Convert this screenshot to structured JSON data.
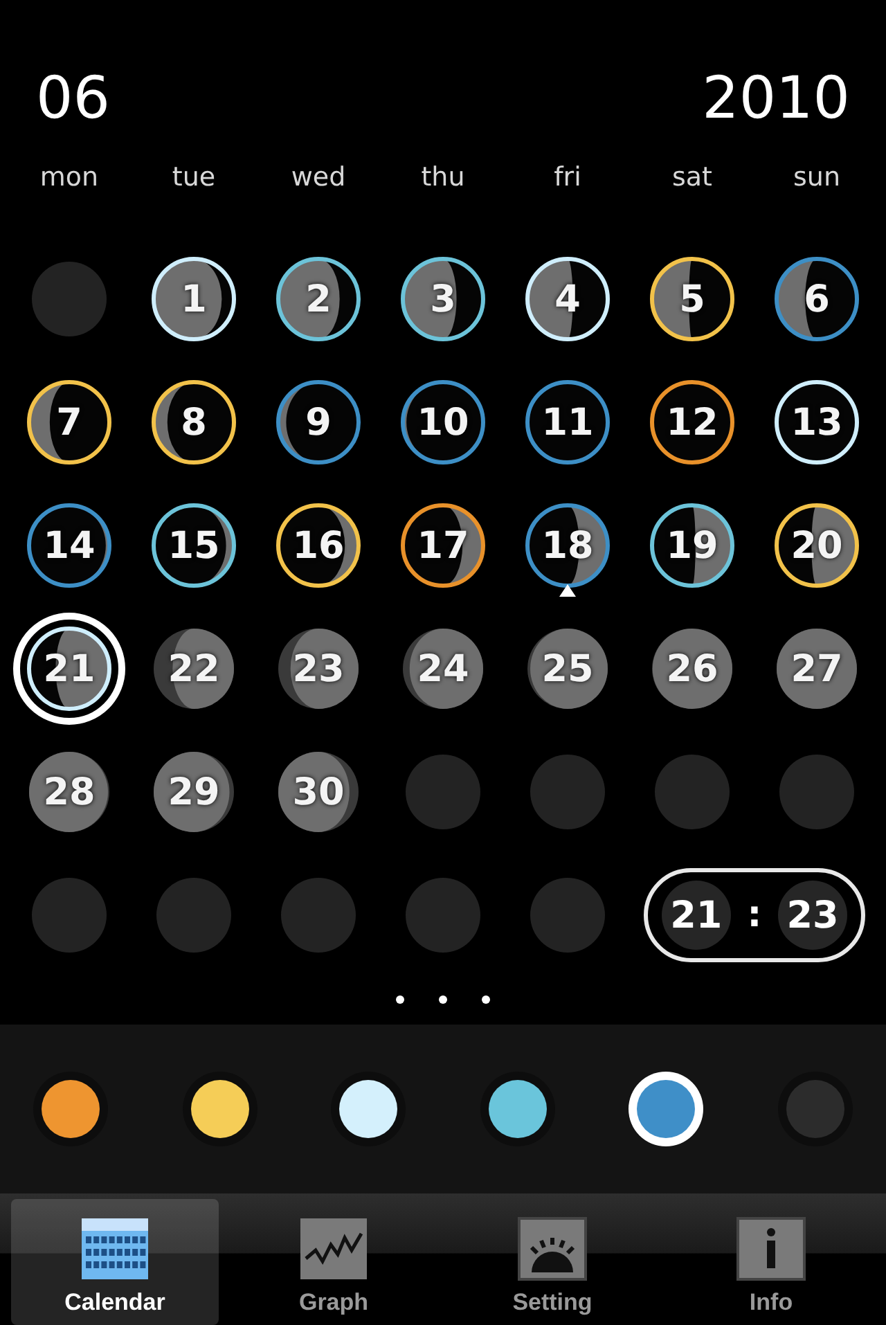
{
  "header": {
    "month": "06",
    "year": "2010"
  },
  "weekdays": [
    "mon",
    "tue",
    "wed",
    "thu",
    "fri",
    "sat",
    "sun"
  ],
  "days": [
    {
      "kind": "empty"
    },
    {
      "kind": "day",
      "label": "1",
      "color": "#cfeefc",
      "selected": false,
      "today": false
    },
    {
      "kind": "day",
      "label": "2",
      "color": "#6cc3d9",
      "selected": false,
      "today": false
    },
    {
      "kind": "day",
      "label": "3",
      "color": "#6cc3d9",
      "selected": false,
      "today": false
    },
    {
      "kind": "day",
      "label": "4",
      "color": "#cfeefc",
      "selected": false,
      "today": false
    },
    {
      "kind": "day",
      "label": "5",
      "color": "#f2c24a",
      "selected": false,
      "today": false
    },
    {
      "kind": "day",
      "label": "6",
      "color": "#3d8fc6",
      "selected": false,
      "today": false
    },
    {
      "kind": "day",
      "label": "7",
      "color": "#f2c24a",
      "selected": false,
      "today": false
    },
    {
      "kind": "day",
      "label": "8",
      "color": "#f2c24a",
      "selected": false,
      "today": false
    },
    {
      "kind": "day",
      "label": "9",
      "color": "#3d8fc6",
      "selected": false,
      "today": false
    },
    {
      "kind": "day",
      "label": "10",
      "color": "#3d8fc6",
      "selected": false,
      "today": false
    },
    {
      "kind": "day",
      "label": "11",
      "color": "#3d8fc6",
      "selected": false,
      "today": false
    },
    {
      "kind": "day",
      "label": "12",
      "color": "#e8912a",
      "selected": false,
      "today": false
    },
    {
      "kind": "day",
      "label": "13",
      "color": "#cfeefc",
      "selected": false,
      "today": false
    },
    {
      "kind": "day",
      "label": "14",
      "color": "#3d8fc6",
      "selected": false,
      "today": false
    },
    {
      "kind": "day",
      "label": "15",
      "color": "#6cc3d9",
      "selected": false,
      "today": false
    },
    {
      "kind": "day",
      "label": "16",
      "color": "#f2c24a",
      "selected": false,
      "today": false
    },
    {
      "kind": "day",
      "label": "17",
      "color": "#e8912a",
      "selected": false,
      "today": false
    },
    {
      "kind": "day",
      "label": "18",
      "color": "#3d8fc6",
      "selected": false,
      "today": true
    },
    {
      "kind": "day",
      "label": "19",
      "color": "#6cc3d9",
      "selected": false,
      "today": false
    },
    {
      "kind": "day",
      "label": "20",
      "color": "#f2c24a",
      "selected": false,
      "today": false
    },
    {
      "kind": "day",
      "label": "21",
      "color": "#cfeefc",
      "selected": true,
      "today": false
    },
    {
      "kind": "day",
      "label": "22",
      "selected": false,
      "today": false
    },
    {
      "kind": "day",
      "label": "23",
      "selected": false,
      "today": false
    },
    {
      "kind": "day",
      "label": "24",
      "selected": false,
      "today": false
    },
    {
      "kind": "day",
      "label": "25",
      "selected": false,
      "today": false
    },
    {
      "kind": "day",
      "label": "26",
      "selected": false,
      "today": false
    },
    {
      "kind": "day",
      "label": "27",
      "selected": false,
      "today": false
    },
    {
      "kind": "day",
      "label": "28",
      "selected": false,
      "today": false
    },
    {
      "kind": "day",
      "label": "29",
      "selected": false,
      "today": false
    },
    {
      "kind": "day",
      "label": "30",
      "selected": false,
      "today": false
    },
    {
      "kind": "empty"
    },
    {
      "kind": "empty"
    },
    {
      "kind": "empty"
    },
    {
      "kind": "empty"
    },
    {
      "kind": "empty"
    },
    {
      "kind": "empty"
    },
    {
      "kind": "empty"
    },
    {
      "kind": "empty"
    },
    {
      "kind": "empty"
    }
  ],
  "time": {
    "hour": "21",
    "separator": ":",
    "minute": "23"
  },
  "palette": [
    {
      "color": "#ee9530",
      "selected": false
    },
    {
      "color": "#f5cd57",
      "selected": false
    },
    {
      "color": "#d4f0fc",
      "selected": false
    },
    {
      "color": "#6ac5db",
      "selected": false
    },
    {
      "color": "#3f8fc8",
      "selected": true
    },
    {
      "color": "#2c2c2c",
      "selected": false
    }
  ],
  "tabs": [
    {
      "kind": "calendar",
      "label": "Calendar",
      "selected": true
    },
    {
      "kind": "graph",
      "label": "Graph",
      "selected": false
    },
    {
      "kind": "setting",
      "label": "Setting",
      "selected": false
    },
    {
      "kind": "info",
      "label": "Info",
      "selected": false
    }
  ]
}
